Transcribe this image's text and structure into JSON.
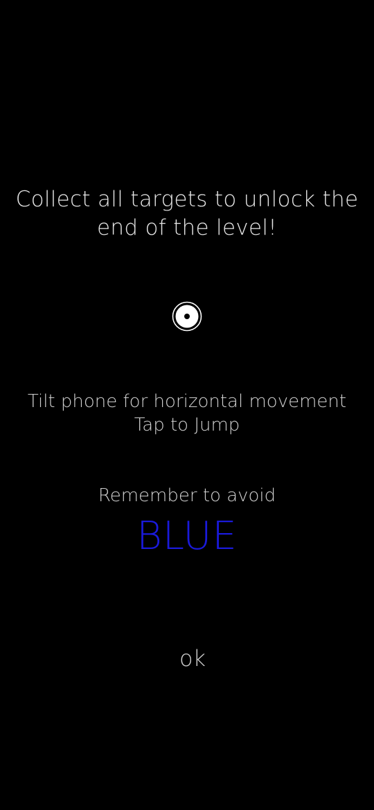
{
  "instructions": {
    "headline_line1": "Collect all targets to unlock the",
    "headline_line2": "end of the level!",
    "controls_line1": "Tilt phone for horizontal movement",
    "controls_line2": "Tap to Jump",
    "remember_text": "Remember to avoid",
    "avoid_color_word": "BLUE"
  },
  "target_icon": "target-icon",
  "ok_button_label": "ok",
  "colors": {
    "background": "#000000",
    "text": "#d9d9d9",
    "avoid_blue": "#1a1adb"
  }
}
